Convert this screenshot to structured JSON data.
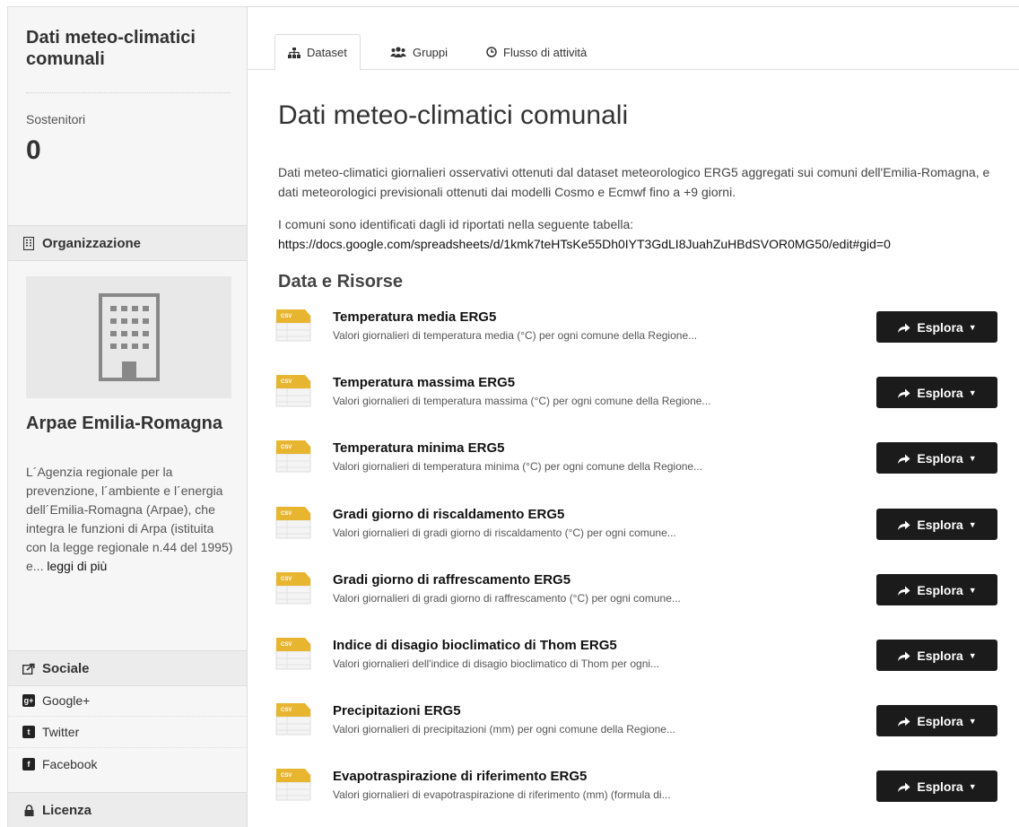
{
  "sidebar": {
    "title": "Dati meteo-climatici comunali",
    "followers_label": "Sostenitori",
    "followers_count": "0",
    "org_heading": "Organizzazione",
    "org_name": "Arpae Emilia-Romagna",
    "org_description": "L´Agenzia regionale per la prevenzione, l´ambiente e l´energia dell´Emilia-Romagna (Arpae), che integra le funzioni di Arpa (istituita con la legge regionale n.44 del 1995) e...",
    "org_read_more": "leggi di più",
    "social_heading": "Sociale",
    "social": [
      "Google+",
      "Twitter",
      "Facebook"
    ],
    "license_heading": "Licenza"
  },
  "tabs": [
    "Dataset",
    "Gruppi",
    "Flusso di attività"
  ],
  "main": {
    "title": "Dati meteo-climatici comunali",
    "description": "Dati meteo-climatici giornalieri osservativi ottenuti dal dataset meteorologico ERG5 aggregati sui comuni dell'Emilia-Romagna, e dati meteorologici previsionali ottenuti dai modelli Cosmo e Ecmwf fino a +9 giorni.",
    "description2": "I comuni sono identificati dagli id riportati nella seguente tabella:",
    "url": "https://docs.google.com/spreadsheets/d/1kmk7teHTsKe55Dh0IYT3GdLI8JuahZuHBdSVOR0MG50/edit#gid=0",
    "section_title": "Data e Risorse",
    "explore_label": "Esplora",
    "csv_label": "CSV",
    "resources": [
      {
        "title": "Temperatura media ERG5",
        "desc": "Valori giornalieri di temperatura media (°C) per ogni comune della Regione..."
      },
      {
        "title": "Temperatura massima ERG5",
        "desc": "Valori giornalieri di temperatura massima (°C) per ogni comune della Regione..."
      },
      {
        "title": "Temperatura minima ERG5",
        "desc": "Valori giornalieri di temperatura minima (°C) per ogni comune della Regione..."
      },
      {
        "title": "Gradi giorno di riscaldamento ERG5",
        "desc": "Valori giornalieri di gradi giorno di riscaldamento (°C) per ogni comune..."
      },
      {
        "title": "Gradi giorno di raffrescamento ERG5",
        "desc": "Valori giornalieri di gradi giorno di raffrescamento (°C) per ogni comune..."
      },
      {
        "title": "Indice di disagio bioclimatico di Thom ERG5",
        "desc": "Valori giornalieri dell'indice di disagio bioclimatico di Thom per ogni..."
      },
      {
        "title": "Precipitazioni ERG5",
        "desc": "Valori giornalieri di precipitazioni (mm) per ogni comune della Regione..."
      },
      {
        "title": "Evapotraspirazione di riferimento ERG5",
        "desc": "Valori giornalieri di evapotraspirazione di riferimento (mm) (formula di..."
      }
    ]
  }
}
